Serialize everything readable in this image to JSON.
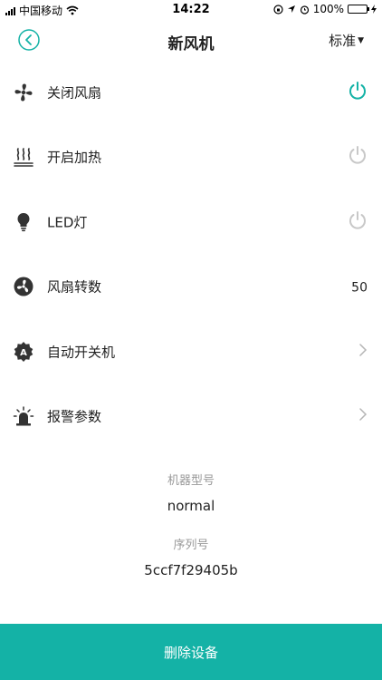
{
  "status_bar": {
    "carrier": "中国移动",
    "time": "14:22",
    "battery": "100%"
  },
  "nav": {
    "title": "新风机",
    "mode": "标准",
    "back_icon": "chevron-left-circle-icon"
  },
  "rows": [
    {
      "label": "关闭风扇",
      "icon": "fan-icon",
      "control": "power",
      "power_on": true
    },
    {
      "label": "开启加热",
      "icon": "heat-waves-icon",
      "control": "power",
      "power_on": false
    },
    {
      "label": "LED灯",
      "icon": "bulb-icon",
      "control": "power",
      "power_on": false
    },
    {
      "label": "风扇转数",
      "icon": "fan-speed-icon",
      "control": "value",
      "value": "50"
    },
    {
      "label": "自动开关机",
      "icon": "auto-icon",
      "control": "chevron"
    },
    {
      "label": "报警参数",
      "icon": "alarm-icon",
      "control": "chevron"
    }
  ],
  "info": {
    "model_label": "机器型号",
    "model_value": "normal",
    "serial_label": "序列号",
    "serial_value": "5ccf7f29405b"
  },
  "footer": {
    "delete_label": "删除设备"
  },
  "colors": {
    "accent": "#14b2a6",
    "power_off": "#c8c8c8",
    "icon": "#333333"
  }
}
